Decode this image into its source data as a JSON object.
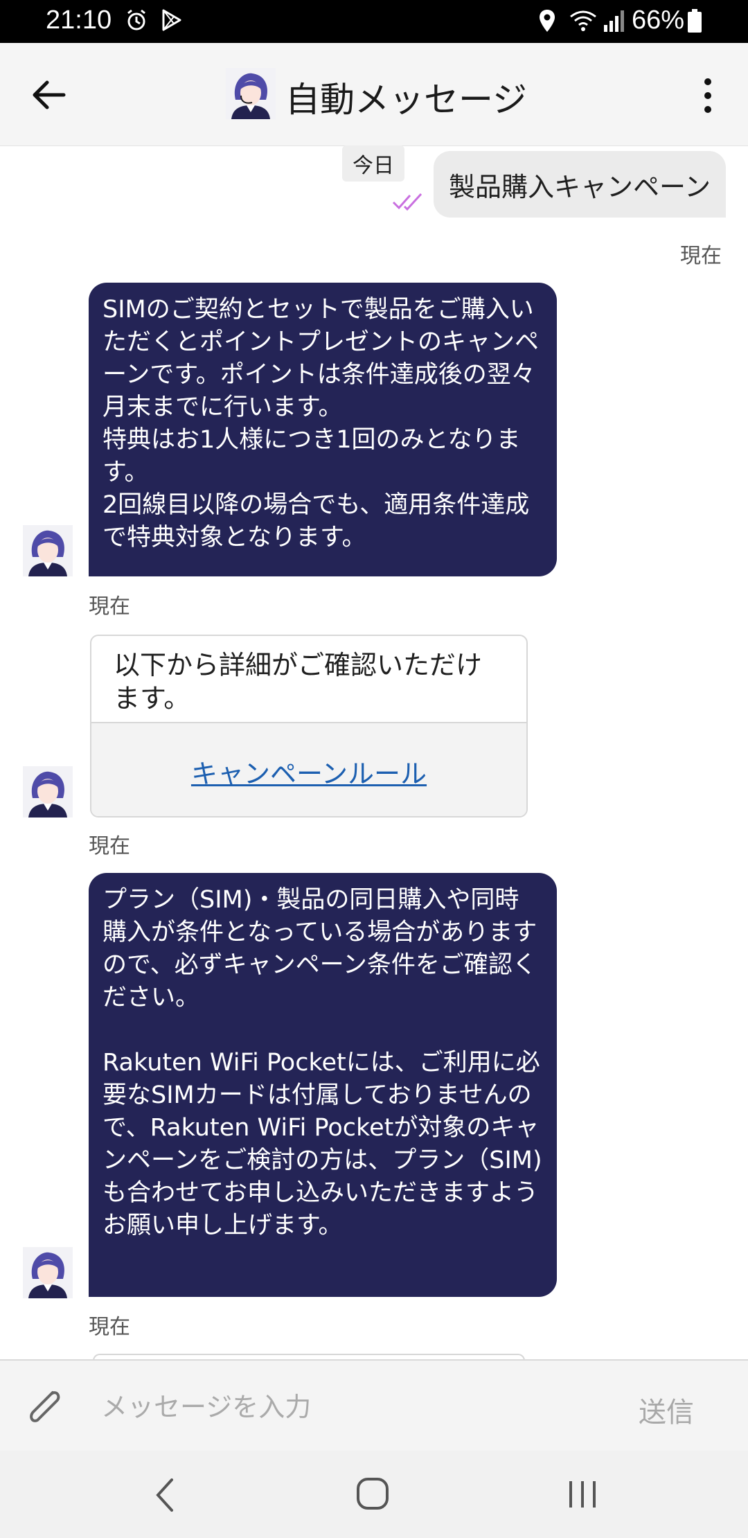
{
  "status_bar": {
    "time": "21:10",
    "battery_percent": "66%",
    "icons": [
      "alarm-icon",
      "play-store-icon",
      "location-icon",
      "wifi-icon",
      "signal-icon",
      "battery-icon"
    ]
  },
  "header": {
    "title": "自動メッセージ",
    "icons": [
      "back-arrow-icon",
      "operator-avatar-icon",
      "more-vert-icon"
    ]
  },
  "chat": {
    "day_label": "今日",
    "user_message": {
      "text": "製品購入キャンペーン",
      "timestamp": "現在"
    },
    "messages": [
      {
        "text": "SIMのご契約とセットで製品をご購入いただくとポイントプレゼントのキャンペーンです。ポイントは条件達成後の翌々月末までに行います。\n特典はお1人様につき1回のみとなります。\n2回線目以降の場合でも、適用条件達成で特典対象となります。",
        "timestamp": "現在"
      },
      {
        "card_text": "以下から詳細がご確認いただけます。",
        "link_label": "キャンペーンルール",
        "timestamp": "現在"
      },
      {
        "text": "プラン（SIM)・製品の同日購入や同時購入が条件となっている場合がありますので、必ずキャンペーン条件をご確認ください。\n\nRakuten WiFi Pocketには、ご利用に必要なSIMカードは付属しておりませんので、Rakuten WiFi Pocketが対象のキャンペーンをご検討の方は、プラン（SIM)も合わせてお申し込みいただきますようお願い申し上げます。",
        "timestamp": "現在"
      }
    ]
  },
  "input_bar": {
    "placeholder": "メッセージを入力",
    "send_label": "送信"
  },
  "nav_bar": {
    "icons": [
      "nav-back-icon",
      "nav-home-icon",
      "nav-recents-icon"
    ]
  },
  "colors": {
    "bot_bubble": "#242456",
    "user_bubble": "#ebebeb",
    "link": "#1c5fb0",
    "read_check": "#c96fe0"
  }
}
